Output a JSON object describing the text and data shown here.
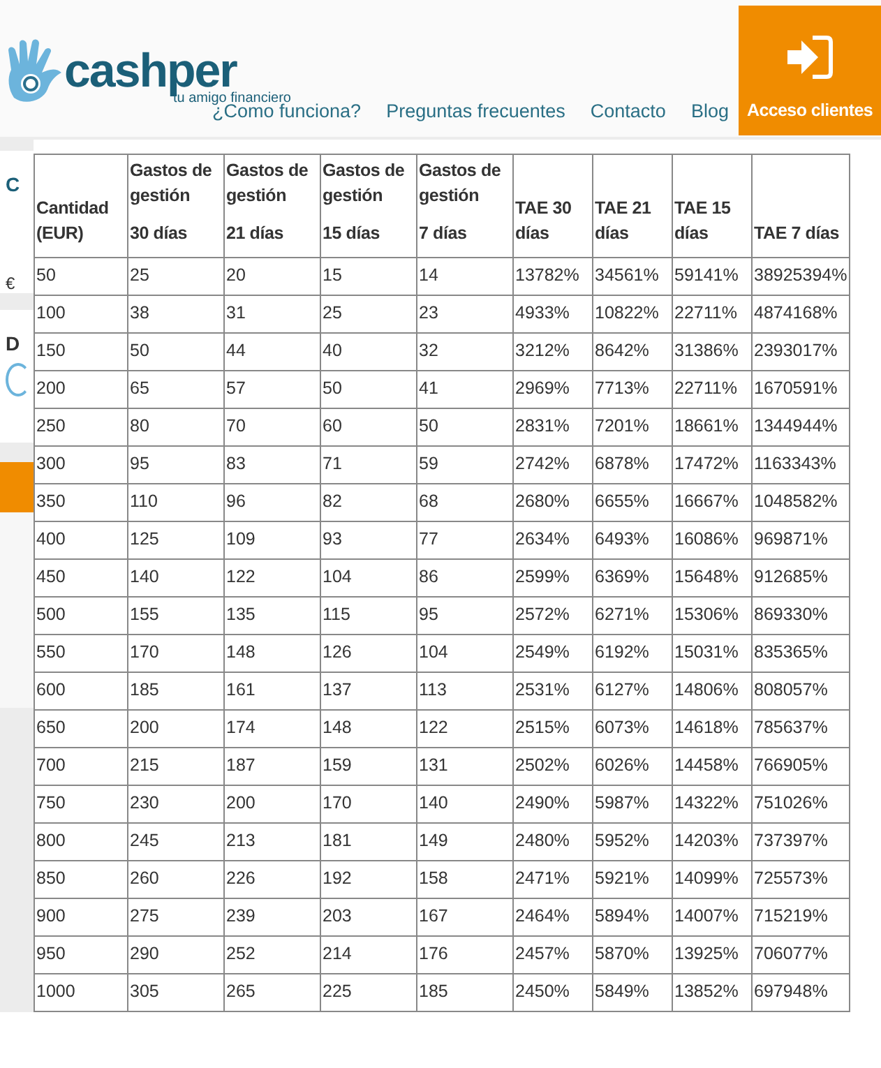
{
  "header": {
    "logo": {
      "name": "cashper",
      "tagline": "tu amigo financiero"
    },
    "nav": [
      "¿Como funciona?",
      "Preguntas frecuentes",
      "Contacto",
      "Blog"
    ],
    "login_button": "Acceso clientes"
  },
  "side_fragments": [
    "C",
    "€",
    "D"
  ],
  "table": {
    "columns": [
      {
        "title": "Cantidad (EUR)"
      },
      {
        "title": "Gastos de gestión",
        "period": "30 días"
      },
      {
        "title": "Gastos de gestión",
        "period": "21 días"
      },
      {
        "title": "Gastos de gestión",
        "period": "15 días"
      },
      {
        "title": "Gastos de gestión",
        "period": "7 días"
      },
      {
        "title": "TAE 30 días"
      },
      {
        "title": "TAE 21 días"
      },
      {
        "title": "TAE 15 días"
      },
      {
        "title": "TAE 7 días"
      }
    ],
    "rows": [
      [
        "50",
        "25",
        "20",
        "15",
        "14",
        "13782%",
        "34561%",
        "59141%",
        "38925394%"
      ],
      [
        "100",
        "38",
        "31",
        "25",
        "23",
        "4933%",
        "10822%",
        "22711%",
        "4874168%"
      ],
      [
        "150",
        "50",
        "44",
        "40",
        "32",
        "3212%",
        "8642%",
        "31386%",
        "2393017%"
      ],
      [
        "200",
        "65",
        "57",
        "50",
        "41",
        "2969%",
        "7713%",
        "22711%",
        "1670591%"
      ],
      [
        "250",
        "80",
        "70",
        "60",
        "50",
        "2831%",
        "7201%",
        "18661%",
        "1344944%"
      ],
      [
        "300",
        "95",
        "83",
        "71",
        "59",
        "2742%",
        "6878%",
        "17472%",
        "1163343%"
      ],
      [
        "350",
        "110",
        "96",
        "82",
        "68",
        "2680%",
        "6655%",
        "16667%",
        "1048582%"
      ],
      [
        "400",
        "125",
        "109",
        "93",
        "77",
        "2634%",
        "6493%",
        "16086%",
        "969871%"
      ],
      [
        "450",
        "140",
        "122",
        "104",
        "86",
        "2599%",
        "6369%",
        "15648%",
        "912685%"
      ],
      [
        "500",
        "155",
        "135",
        "115",
        "95",
        "2572%",
        "6271%",
        "15306%",
        "869330%"
      ],
      [
        "550",
        "170",
        "148",
        "126",
        "104",
        "2549%",
        "6192%",
        "15031%",
        "835365%"
      ],
      [
        "600",
        "185",
        "161",
        "137",
        "113",
        "2531%",
        "6127%",
        "14806%",
        "808057%"
      ],
      [
        "650",
        "200",
        "174",
        "148",
        "122",
        "2515%",
        "6073%",
        "14618%",
        "785637%"
      ],
      [
        "700",
        "215",
        "187",
        "159",
        "131",
        "2502%",
        "6026%",
        "14458%",
        "766905%"
      ],
      [
        "750",
        "230",
        "200",
        "170",
        "140",
        "2490%",
        "5987%",
        "14322%",
        "751026%"
      ],
      [
        "800",
        "245",
        "213",
        "181",
        "149",
        "2480%",
        "5952%",
        "14203%",
        "737397%"
      ],
      [
        "850",
        "260",
        "226",
        "192",
        "158",
        "2471%",
        "5921%",
        "14099%",
        "725573%"
      ],
      [
        "900",
        "275",
        "239",
        "203",
        "167",
        "2464%",
        "5894%",
        "14007%",
        "715219%"
      ],
      [
        "950",
        "290",
        "252",
        "214",
        "176",
        "2457%",
        "5870%",
        "13925%",
        "706077%"
      ],
      [
        "1000",
        "305",
        "265",
        "225",
        "185",
        "2450%",
        "5849%",
        "13852%",
        "697948%"
      ]
    ]
  }
}
